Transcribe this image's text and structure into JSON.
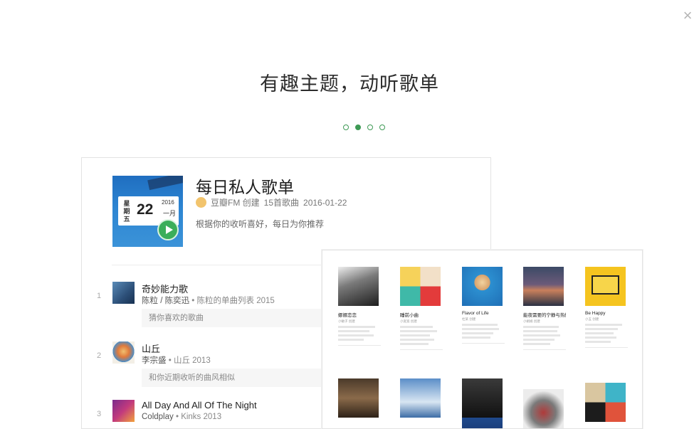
{
  "close_glyph": "×",
  "headline": "有趣主题，动听歌单",
  "pager": {
    "count": 4,
    "active_index": 1
  },
  "playlist": {
    "title": "每日私人歌单",
    "creator": "豆瓣FM 创建",
    "song_count": "15首歌曲",
    "date": "2016-01-22",
    "description": "根据你的收听喜好，每日为你推荐",
    "cover": {
      "weekday": "星期五",
      "day": "22",
      "year": "2016",
      "month": "一月"
    }
  },
  "tracks": [
    {
      "index": "1",
      "title": "奇妙能力歌",
      "artists": "陈粒 / 陈奕迅",
      "album": "陈粒的单曲列表 2015",
      "reason": "猜你喜欢的歌曲"
    },
    {
      "index": "2",
      "title": "山丘",
      "artists": "李宗盛",
      "album": "山丘 2013",
      "reason": "和你近期收听的曲风相似"
    },
    {
      "index": "3",
      "title": "All Day And All Of The Night",
      "artists": "Coldplay",
      "album": "Kinks 2013",
      "reason": ""
    }
  ],
  "albums_row1": [
    {
      "title": "娜娜恋恋",
      "byline": "小敏子 创建"
    },
    {
      "title": "睡前小曲",
      "byline": "小宽宽 创建"
    },
    {
      "title": "Flavor of Life",
      "byline": "杜某 创建"
    },
    {
      "title": "能夜需要的宁静与热情",
      "byline": "小娟娟 创建"
    },
    {
      "title": "Be Happy",
      "byline": "小五 创建"
    }
  ],
  "colors": {
    "accent": "#3e9a55",
    "play": "#3bae5a"
  }
}
